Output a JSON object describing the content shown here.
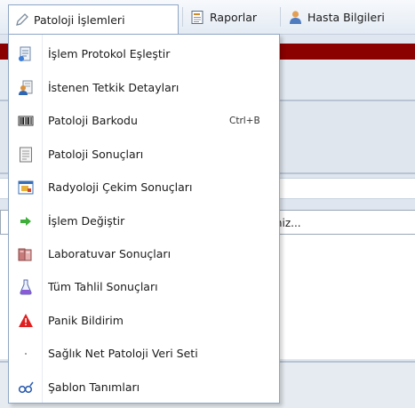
{
  "menubar": {
    "tabs": [
      {
        "label": "Patoloji İşlemleri",
        "icon": "pencil-icon"
      },
      {
        "label": "Raporlar",
        "icon": "report-icon"
      },
      {
        "label": "Hasta Bilgileri",
        "icon": "patient-icon"
      }
    ]
  },
  "dropdown": {
    "items": [
      {
        "label": "İşlem Protokol Eşleştir",
        "icon": "document-link-icon"
      },
      {
        "label": "İstenen Tetkik Detayları",
        "icon": "document-user-icon"
      },
      {
        "label": "Patoloji Barkodu",
        "icon": "barcode-icon",
        "shortcut": "Ctrl+B"
      },
      {
        "label": "Patoloji Sonuçları",
        "icon": "report-sheet-icon"
      },
      {
        "label": "Radyoloji Çekim Sonuçları",
        "icon": "radiology-window-icon"
      },
      {
        "label": "İşlem Değiştir",
        "icon": "green-arrow-icon"
      },
      {
        "label": "Laboratuvar Sonuçları",
        "icon": "lab-books-icon"
      },
      {
        "label": "Tüm Tahlil Sonuçları",
        "icon": "flask-icon"
      },
      {
        "label": "Panik Bildirim",
        "icon": "warning-icon"
      },
      {
        "label": "Sağlık Net Patoloji Veri Seti",
        "icon": "dot-icon"
      },
      {
        "label": "Şablon Tanımları",
        "icon": "template-icon"
      }
    ]
  },
  "background": {
    "field_text": "çiniz..."
  },
  "colors": {
    "menubar_top": "#f7f9fc",
    "menubar_bottom": "#e4ebf4",
    "dark_red_band": "#8b0000",
    "menu_border": "#8fa6c4"
  }
}
